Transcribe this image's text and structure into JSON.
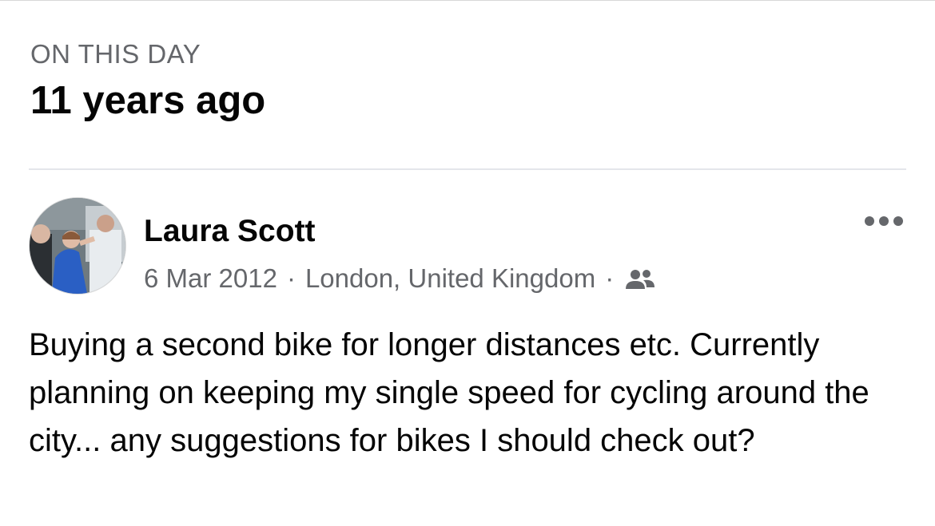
{
  "memory": {
    "overline": "ON THIS DAY",
    "heading": "11 years ago"
  },
  "post": {
    "author": "Laura Scott",
    "date": "6 Mar 2012",
    "separator": "·",
    "location": "London, United Kingdom",
    "audience_icon": "friends-icon",
    "more_icon": "more-options-icon",
    "text": "Buying a second bike for longer distances etc. Currently planning on keeping my single speed for cycling around the city... any suggestions for bikes I should check out?"
  },
  "colors": {
    "primary_text": "#050505",
    "secondary_text": "#65676b",
    "divider": "#e4e6eb"
  }
}
